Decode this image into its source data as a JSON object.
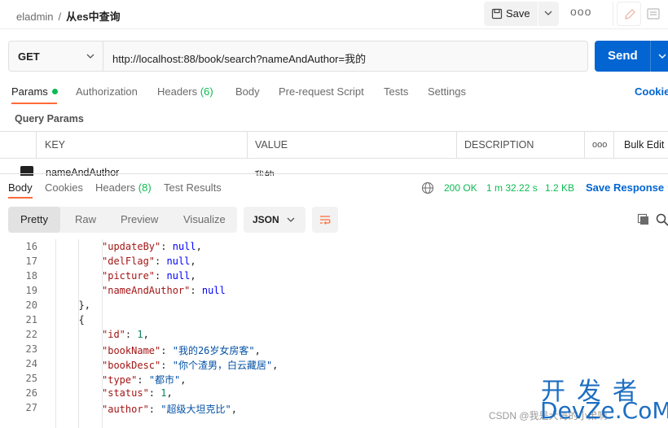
{
  "breadcrumb": {
    "workspace": "eladmin",
    "separator": "/",
    "request": "从es中查询"
  },
  "toolbar": {
    "save_label": "Save",
    "more": "ooo"
  },
  "request": {
    "method": "GET",
    "url": "http://localhost:88/book/search?nameAndAuthor=我的",
    "send_label": "Send"
  },
  "request_tabs": [
    {
      "label": "Params",
      "active": true
    },
    {
      "label": "Authorization"
    },
    {
      "label": "Headers",
      "count": "(6)"
    },
    {
      "label": "Body"
    },
    {
      "label": "Pre-request Script"
    },
    {
      "label": "Tests"
    },
    {
      "label": "Settings"
    }
  ],
  "cookies_label": "Cookie",
  "query_params": {
    "title": "Query Params",
    "headers": [
      "KEY",
      "VALUE",
      "DESCRIPTION",
      "ooo",
      "Bulk Edit"
    ],
    "rows": [
      {
        "key": "nameAndAuthor",
        "value": "我的"
      }
    ]
  },
  "response_tabs": [
    {
      "label": "Body",
      "active": true
    },
    {
      "label": "Cookies"
    },
    {
      "label": "Headers",
      "count": "(8)"
    },
    {
      "label": "Test Results"
    }
  ],
  "response_status": {
    "code": "200 OK",
    "time": "1 m 32.22 s",
    "size": "1.2 KB",
    "save_label": "Save Response"
  },
  "format_tabs": [
    "Pretty",
    "Raw",
    "Preview",
    "Visualize"
  ],
  "format_select": "JSON",
  "code_lines": [
    {
      "n": "16",
      "text": "\"updateBy\": null,"
    },
    {
      "n": "17",
      "text": "\"delFlag\": null,"
    },
    {
      "n": "18",
      "text": "\"picture\": null,"
    },
    {
      "n": "19",
      "text": "\"nameAndAuthor\": null"
    },
    {
      "n": "20",
      "text": "},"
    },
    {
      "n": "21",
      "text": "{"
    },
    {
      "n": "22",
      "text": "\"id\": 1,"
    },
    {
      "n": "23",
      "text": "\"bookName\": \"我的26岁女房客\","
    },
    {
      "n": "24",
      "text": "\"bookDesc\": \"你个渣男，白云藏居\","
    },
    {
      "n": "25",
      "text": "\"type\": \"都市\","
    },
    {
      "n": "26",
      "text": "\"status\": 1,"
    },
    {
      "n": "27",
      "text": "\"author\": \"超级大坦克比\","
    }
  ],
  "watermark": {
    "cn": "开发者",
    "en": "DevZe.CoM",
    "csdn": "CSDN @我是大哥的小弟啊"
  },
  "colors": {
    "accent": "#ff6c37",
    "send": "#0265d2",
    "ok": "#0cbb52"
  }
}
